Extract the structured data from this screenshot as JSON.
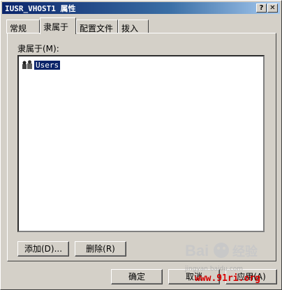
{
  "window": {
    "title": "IUSR_VHOST1 属性"
  },
  "titlebar_buttons": {
    "help": "?",
    "close": "✕"
  },
  "tabs": [
    {
      "label": "常规"
    },
    {
      "label": "隶属于"
    },
    {
      "label": "配置文件"
    },
    {
      "label": "拨入"
    }
  ],
  "panel": {
    "member_label": "隶属于(M):",
    "items": [
      {
        "label": "Users",
        "icon": "group-icon"
      }
    ],
    "add_button": "添加(D)...",
    "remove_button": "删除(R)"
  },
  "footer": {
    "ok": "确定",
    "cancel": "取消",
    "apply": "应用(A)"
  },
  "watermark": {
    "brand": "Bai百 经验",
    "site": "jingyan.baidu.com",
    "url": "www.91ri.org"
  }
}
